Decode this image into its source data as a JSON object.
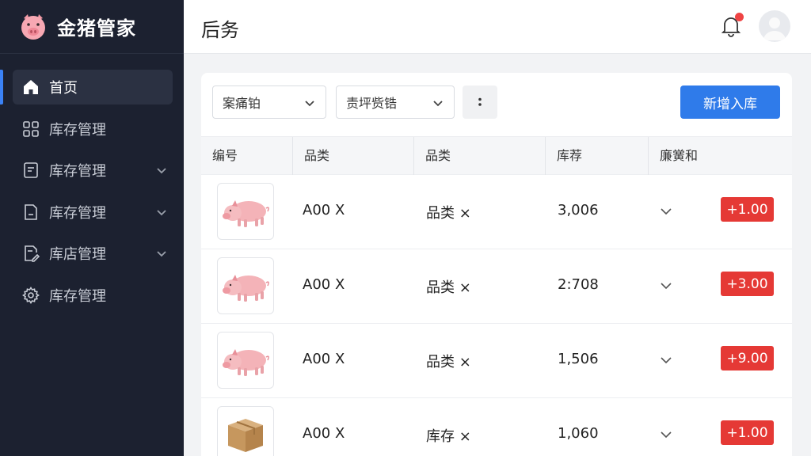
{
  "app": {
    "name": "金猪管家"
  },
  "sidebar": {
    "items": [
      {
        "label": "首页",
        "icon": "home-icon",
        "active": true,
        "expandable": false
      },
      {
        "label": "库存管理",
        "icon": "grid-icon",
        "active": false,
        "expandable": false
      },
      {
        "label": "库存管理",
        "icon": "document-icon",
        "active": false,
        "expandable": true
      },
      {
        "label": "库存管理",
        "icon": "file-minus-icon",
        "active": false,
        "expandable": true
      },
      {
        "label": "库店管理",
        "icon": "file-edit-icon",
        "active": false,
        "expandable": true
      },
      {
        "label": "库存管理",
        "icon": "gear-icon",
        "active": false,
        "expandable": false
      }
    ]
  },
  "header": {
    "title": "后务"
  },
  "toolbar": {
    "filter1": "案痛铂",
    "filter2": "责坪赀锆",
    "add_label": "新增入库"
  },
  "table": {
    "columns": [
      "编号",
      "品类",
      "品类",
      "库荐",
      "廉黉和"
    ],
    "rows": [
      {
        "image": "pig",
        "code": "A00 X",
        "category": "品类 ×",
        "stock": "3,006",
        "change": "+1.00"
      },
      {
        "image": "pig",
        "code": "A00 X",
        "category": "品类 ×",
        "stock": "2:708",
        "change": "+3.00"
      },
      {
        "image": "pig",
        "code": "A00 X",
        "category": "品类 ×",
        "stock": "1,506",
        "change": "+9.00"
      },
      {
        "image": "box",
        "code": "A00 X",
        "category": "库存 ×",
        "stock": "1,060",
        "change": "+1.00"
      }
    ]
  },
  "colors": {
    "sidebar_bg": "#1c2130",
    "accent": "#2f7bea",
    "badge": "#e53935",
    "notification": "#ef4444"
  }
}
